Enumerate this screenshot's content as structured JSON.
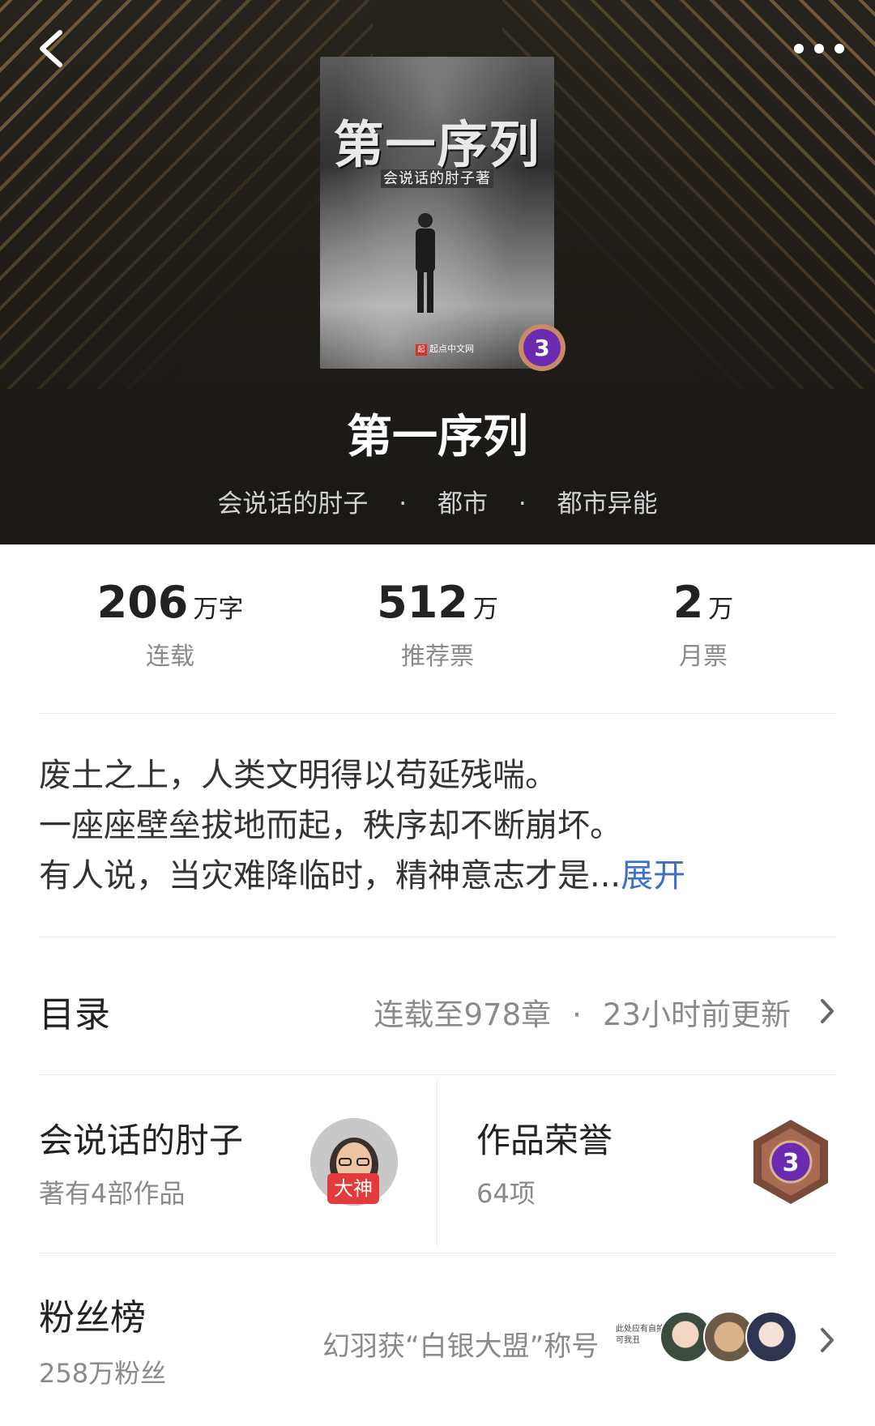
{
  "header": {
    "back_label": "back",
    "more_label": "more"
  },
  "cover": {
    "title": "第一序列",
    "author": "会说话的肘子著",
    "publisher": "起点中文网",
    "badge_number": "3"
  },
  "book": {
    "title": "第一序列",
    "author": "会说话的肘子",
    "category": "都市",
    "subcategory": "都市异能",
    "separator": "·"
  },
  "stats": [
    {
      "value": "206",
      "unit": "万字",
      "label": "连载"
    },
    {
      "value": "512",
      "unit": "万",
      "label": "推荐票"
    },
    {
      "value": "2",
      "unit": "万",
      "label": "月票"
    }
  ],
  "synopsis": {
    "line1": "废土之上，人类文明得以苟延残喘。",
    "line2": "一座座壁垒拔地而起，秩序却不断崩坏。",
    "line3": "有人说，当灾难降临时，精神意志才是...",
    "expand": "展开"
  },
  "catalog": {
    "title": "目录",
    "status": "连载至978章",
    "updated": "23小时前更新"
  },
  "author_card": {
    "name": "会说话的肘子",
    "works": "著有4部作品",
    "tag": "大神"
  },
  "honor_card": {
    "title": "作品荣誉",
    "count": "64项",
    "badge_number": "3"
  },
  "fans": {
    "title": "粉丝榜",
    "count": "258万粉丝",
    "news": "幻羽获“白银大盟”称号",
    "avatar_text": "此处应有自拍可我丑"
  },
  "colors": {
    "header_bg": "#1f1c18",
    "stripe_gold": "#b08c4e",
    "accent_link": "#3d6ecb",
    "author_tag": "#e33b3b",
    "badge_purple": "#6a2bb0"
  }
}
